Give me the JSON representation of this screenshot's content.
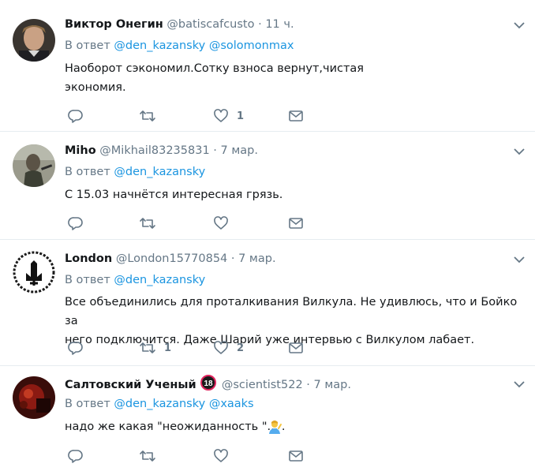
{
  "reply_prefix": "В ответ",
  "tweets": [
    {
      "name": "Виктор Онегин",
      "handle": "@batiscafcusto",
      "dot": "·",
      "time": "11 ч.",
      "mentions": [
        "@den_kazansky",
        "@solomonmax"
      ],
      "text_lines": [
        "Наоборот сэкономил.Сотку взноса вернут,чистая",
        "экономия."
      ],
      "retweets": "",
      "likes": "1"
    },
    {
      "name": "Miho",
      "handle": "@Mikhail83235831",
      "dot": "·",
      "time": "7 мар.",
      "mentions": [
        "@den_kazansky"
      ],
      "text_lines": [
        "С 15.03 начнётся интересная грязь."
      ],
      "retweets": "",
      "likes": ""
    },
    {
      "name": "London",
      "handle": "@London15770854",
      "dot": "·",
      "time": "7 мар.",
      "mentions": [
        "@den_kazansky"
      ],
      "text_lines": [
        "Все объединились для проталкивания Вилкула. Не удивлюсь, что и Бойко за",
        "него подключится. Даже Шарий уже интервью с Вилкулом лабает."
      ],
      "retweets": "1",
      "likes": "2"
    },
    {
      "name": "Салтовский Ученый",
      "badge": "18",
      "handle": "@scientist522",
      "dot": "·",
      "time": "7 мар.",
      "mentions": [
        "@den_kazansky",
        "@xaaks"
      ],
      "text_lines": [
        "надо же какая \"неожиданность \"... ."
      ],
      "retweets": "",
      "likes": ""
    }
  ],
  "icons": {
    "caret": "chevron-down-icon",
    "reply": "reply-icon",
    "retweet": "retweet-icon",
    "like": "heart-icon",
    "message": "envelope-icon",
    "emoji": "person-gesturing-emoji-icon"
  },
  "colors": {
    "link": "#1b95e0",
    "meta": "#657786",
    "text": "#14171a",
    "divider": "#e6ecf0",
    "badge": "#e0245e"
  }
}
